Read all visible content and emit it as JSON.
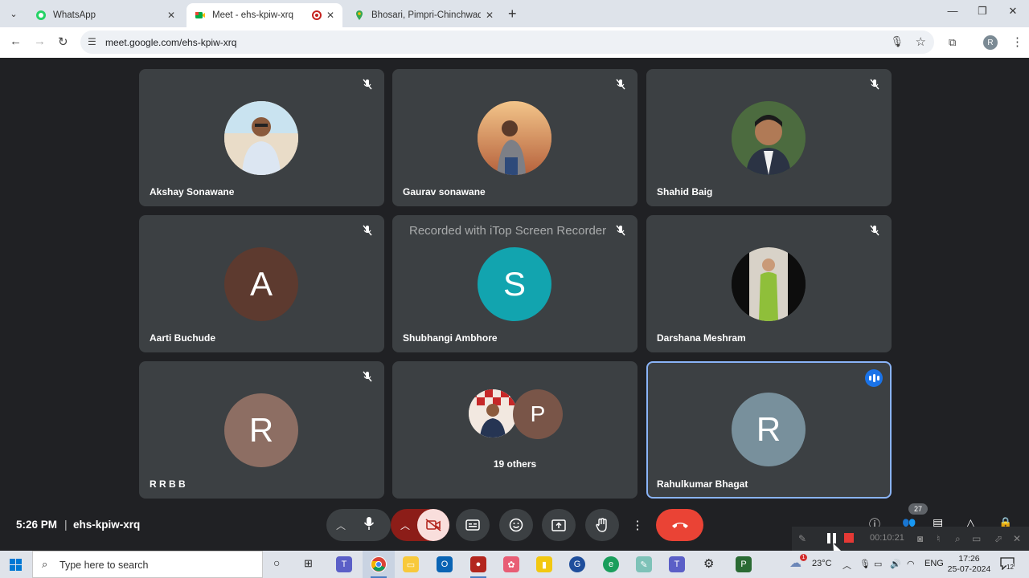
{
  "browser": {
    "tabs": [
      {
        "label": "WhatsApp",
        "active": false
      },
      {
        "label": "Meet - ehs-kpiw-xrq",
        "active": true,
        "recording": true
      },
      {
        "label": "Bhosari, Pimpri-Chinchwad, Ma",
        "active": false
      }
    ],
    "url": "meet.google.com/ehs-kpiw-xrq",
    "profile_initial": "R"
  },
  "meet": {
    "participants": [
      {
        "name": "Akshay Sonawane",
        "avatar": "photo",
        "muted": true
      },
      {
        "name": "Gaurav sonawane",
        "avatar": "photo",
        "muted": true
      },
      {
        "name": "Shahid Baig",
        "avatar": "photo",
        "muted": true
      },
      {
        "name": "Aarti Buchude",
        "avatar": "A",
        "avatar_color": "#5d3a2f",
        "muted": true
      },
      {
        "name": "Shubhangi Ambhore",
        "avatar": "S",
        "avatar_color": "#12a4af",
        "muted": true
      },
      {
        "name": "Darshana Meshram",
        "avatar": "photo",
        "muted": true
      },
      {
        "name": "R R B B",
        "avatar": "R",
        "avatar_color": "#8d6e63",
        "muted": true
      },
      {
        "name": "Rahulkumar Bhagat",
        "avatar": "R",
        "avatar_color": "#78909c",
        "speaking": true
      }
    ],
    "others": {
      "label": "19 others",
      "avatar_letter": "P",
      "avatar_color": "#795548"
    },
    "watermark": "Recorded with iTop Screen Recorder",
    "time": "5:26 PM",
    "separator": "|",
    "meeting_code": "ehs-kpiw-xrq",
    "people_count": "27",
    "accent_red": "#ea4335"
  },
  "recorder": {
    "elapsed": "00:10:21"
  },
  "taskbar": {
    "search_placeholder": "Type here to search",
    "weather": "23°C",
    "language": "ENG",
    "clock_time": "17:26",
    "clock_date": "25-07-2024",
    "weather_badge": "1",
    "notification_count": "12"
  }
}
